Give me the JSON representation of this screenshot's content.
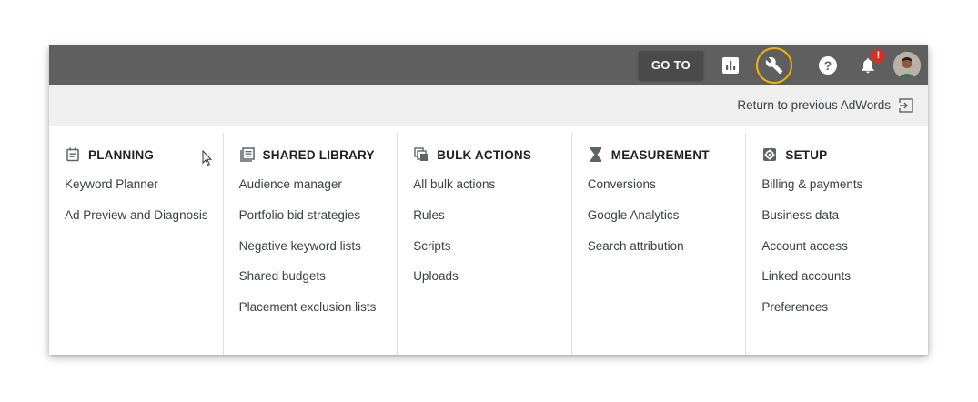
{
  "topbar": {
    "goto_label": "GO TO",
    "icons": [
      "reports-icon",
      "wrench-icon",
      "help-icon",
      "bell-icon"
    ],
    "notification_badge": "!",
    "accent_color": "#f4b400",
    "bar_color": "#5f5f5f"
  },
  "return_link": {
    "label": "Return to previous AdWords"
  },
  "columns": [
    {
      "title": "PLANNING",
      "icon": "planning-icon",
      "items": [
        "Keyword Planner",
        "Ad Preview and Diagnosis"
      ]
    },
    {
      "title": "SHARED LIBRARY",
      "icon": "library-icon",
      "items": [
        "Audience manager",
        "Portfolio bid strategies",
        "Negative keyword lists",
        "Shared budgets",
        "Placement exclusion lists"
      ]
    },
    {
      "title": "BULK ACTIONS",
      "icon": "bulk-actions-icon",
      "items": [
        "All bulk actions",
        "Rules",
        "Scripts",
        "Uploads"
      ]
    },
    {
      "title": "MEASUREMENT",
      "icon": "hourglass-icon",
      "items": [
        "Conversions",
        "Google Analytics",
        "Search attribution"
      ]
    },
    {
      "title": "SETUP",
      "icon": "settings-icon",
      "items": [
        "Billing & payments",
        "Business data",
        "Account access",
        "Linked accounts",
        "Preferences"
      ]
    }
  ]
}
